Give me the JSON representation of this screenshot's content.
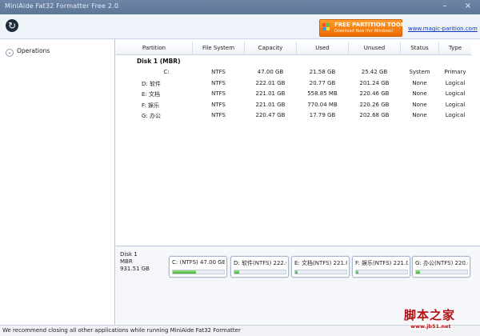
{
  "window": {
    "title": "MiniAide Fat32 Formatter Free 2.0",
    "minimize": "–",
    "close": "×"
  },
  "toolbar": {
    "refresh_glyph": "↻",
    "banner_line1": "FREE PARTITION TOOL",
    "banner_line2": "Download Now (for Windows)",
    "site_link": "www.magic-parition.com"
  },
  "left_panel": {
    "operations_label": "Operations",
    "operations_icon": "chevron-down-icon",
    "operations_glyph": "⌄"
  },
  "table": {
    "columns": [
      "Partition",
      "File System",
      "Capacity",
      "Used",
      "Unused",
      "Status",
      "Type"
    ],
    "disk_label": "Disk 1 (MBR)",
    "rows": [
      {
        "partition": "C:",
        "fs": "NTFS",
        "capacity": "47.00 GB",
        "used": "21.58 GB",
        "unused": "25.42 GB",
        "status": "System",
        "type": "Primary"
      },
      {
        "partition": "D: 软件",
        "fs": "NTFS",
        "capacity": "222.01 GB",
        "used": "20.77 GB",
        "unused": "201.24 GB",
        "status": "None",
        "type": "Logical"
      },
      {
        "partition": "E: 文档",
        "fs": "NTFS",
        "capacity": "221.01 GB",
        "used": "558.85 MB",
        "unused": "220.46 GB",
        "status": "None",
        "type": "Logical"
      },
      {
        "partition": "F: 娱乐",
        "fs": "NTFS",
        "capacity": "221.01 GB",
        "used": "770.04 MB",
        "unused": "220.26 GB",
        "status": "None",
        "type": "Logical"
      },
      {
        "partition": "G: 办公",
        "fs": "NTFS",
        "capacity": "220.47 GB",
        "used": "17.79 GB",
        "unused": "202.68 GB",
        "status": "None",
        "type": "Logical"
      }
    ]
  },
  "disk_map": {
    "disk_name": "Disk 1",
    "disk_style": "MBR",
    "disk_size": "931.51 GB",
    "partitions": [
      {
        "label": "C: (NTFS) 47.00 GB",
        "used_fraction": 0.46
      },
      {
        "label": "D: 软件(NTFS) 222.0",
        "used_fraction": 0.09
      },
      {
        "label": "E: 文档(NTFS) 221.0",
        "used_fraction": 0.0
      },
      {
        "label": "F: 娱乐(NTFS) 221.0",
        "used_fraction": 0.0
      },
      {
        "label": "G: 办公(NTFS) 220.4",
        "used_fraction": 0.08
      }
    ]
  },
  "status_bar": {
    "text": "We recommend closing all other applications while running MiniAide Fat32 Formatter"
  },
  "watermark": {
    "cn": "脚本之家",
    "url": "www.jb51.net"
  }
}
